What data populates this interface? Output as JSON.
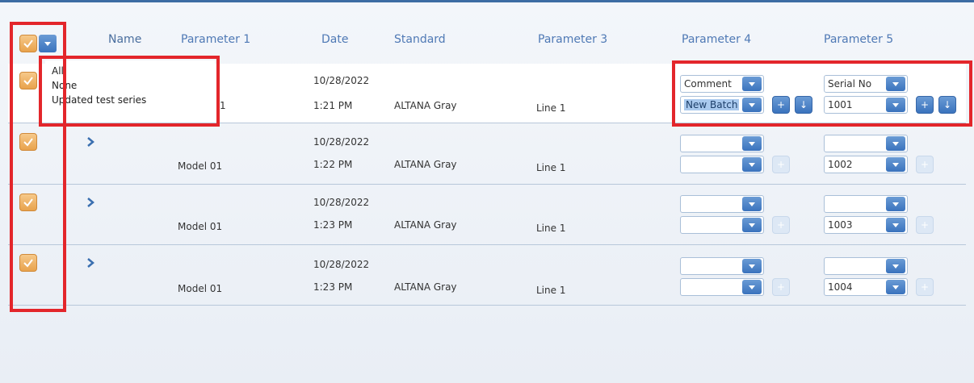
{
  "header": {
    "name": "Name",
    "param1": "Parameter 1",
    "date": "Date",
    "standard": "Standard",
    "param3": "Parameter 3",
    "param4": "Parameter 4",
    "param5": "Parameter 5"
  },
  "select_menu": {
    "items": [
      "All",
      "None",
      "Updated test series"
    ]
  },
  "first_row": {
    "param1_visible": "1",
    "date": "10/28/2022",
    "time": "1:21 PM",
    "standard": "ALTANA Gray",
    "param3": "Line 1",
    "param4_top": "Comment",
    "param4_bottom": "New Batch",
    "param5_top": "Serial No",
    "param5_bottom": "1001",
    "add_label": "+",
    "down_label": "↓"
  },
  "rows": [
    {
      "param1": "Model 01",
      "date": "10/28/2022",
      "time": "1:22 PM",
      "standard": "ALTANA Gray",
      "param3": "Line 1",
      "param5_bottom": "1002",
      "add_label": "+"
    },
    {
      "param1": "Model 01",
      "date": "10/28/2022",
      "time": "1:23 PM",
      "standard": "ALTANA Gray",
      "param3": "Line 1",
      "param5_bottom": "1003",
      "add_label": "+"
    },
    {
      "param1": "Model 01",
      "date": "10/28/2022",
      "time": "1:23 PM",
      "standard": "ALTANA Gray",
      "param3": "Line 1",
      "param5_bottom": "1004",
      "add_label": "+"
    }
  ],
  "colors": {
    "accent_blue": "#3a73bd",
    "checkbox_orange": "#e8a24c",
    "highlight_red": "#e3262b"
  }
}
